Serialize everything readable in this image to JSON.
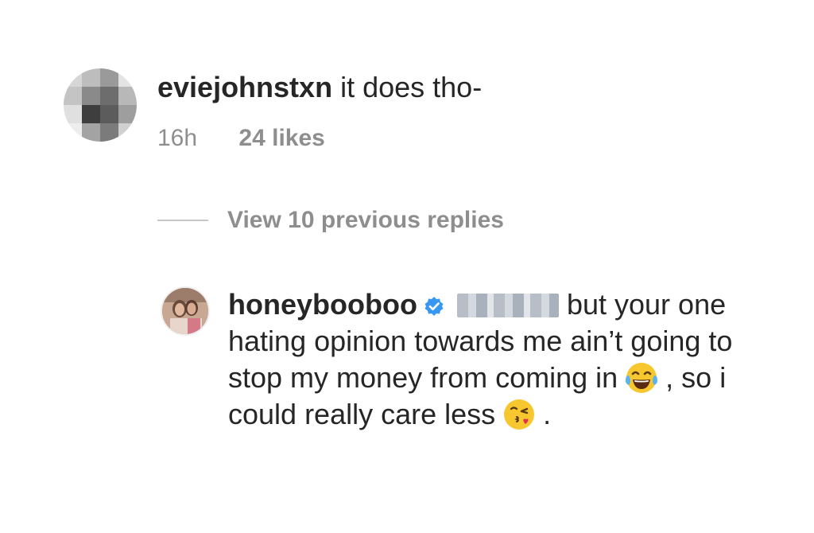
{
  "comment_1": {
    "username": "eviejohnstxn",
    "text": "it does tho-",
    "time": "16h",
    "likes": "24 likes",
    "avatar_icon": "pixelated-avatar"
  },
  "replies": {
    "label": "View 10 previous replies"
  },
  "comment_2": {
    "username": "honeybooboo",
    "verified_icon": "verified-badge-icon",
    "text_1": "but your one hating opinion towards me ain’t going to stop my money from coming in",
    "emoji_1": "face-with-tears-of-joy",
    "text_2": ", so i could really care less",
    "emoji_2": "face-blowing-a-kiss",
    "text_3": "."
  },
  "colors": {
    "text": "#262626",
    "secondary": "#8e8e8e",
    "verified": "#3897f0",
    "divider": "#c7c7c7"
  }
}
